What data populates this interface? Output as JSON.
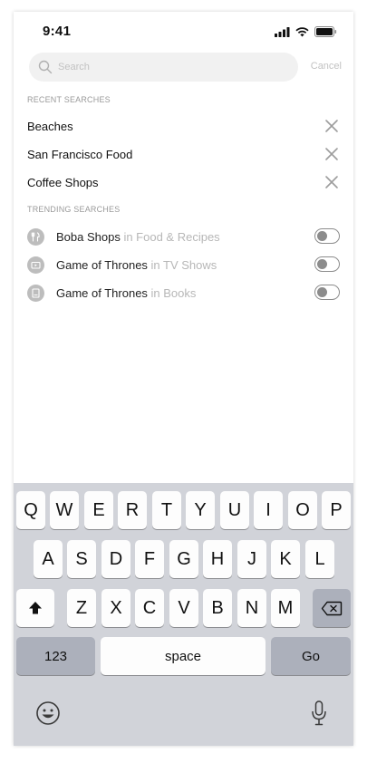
{
  "status": {
    "time": "9:41"
  },
  "search": {
    "placeholder": "Search",
    "cancel_label": "Cancel"
  },
  "recent": {
    "heading": "RECENT SEARCHES",
    "items": [
      {
        "label": "Beaches"
      },
      {
        "label": "San Francisco Food"
      },
      {
        "label": "Coffee Shops"
      }
    ]
  },
  "trending": {
    "heading": "TRENDING SEARCHES",
    "items": [
      {
        "title": "Boba Shops",
        "category": " in Food & Recipes",
        "icon": "fork-knife-icon",
        "enabled": false
      },
      {
        "title": "Game of Thrones",
        "category": " in TV Shows",
        "icon": "tv-icon",
        "enabled": false
      },
      {
        "title": "Game of Thrones",
        "category": " in Books",
        "icon": "book-icon",
        "enabled": false
      }
    ]
  },
  "keyboard": {
    "row1": [
      "Q",
      "W",
      "E",
      "R",
      "T",
      "Y",
      "U",
      "I",
      "O",
      "P"
    ],
    "row2": [
      "A",
      "S",
      "D",
      "F",
      "G",
      "H",
      "J",
      "K",
      "L"
    ],
    "row3": [
      "Z",
      "X",
      "C",
      "V",
      "B",
      "N",
      "M"
    ],
    "numbers_label": "123",
    "space_label": "space",
    "go_label": "Go"
  },
  "colors": {
    "keyboard_bg": "#d1d3d9",
    "key_dark": "#acb0bb",
    "muted_text": "#b7b7b7"
  }
}
